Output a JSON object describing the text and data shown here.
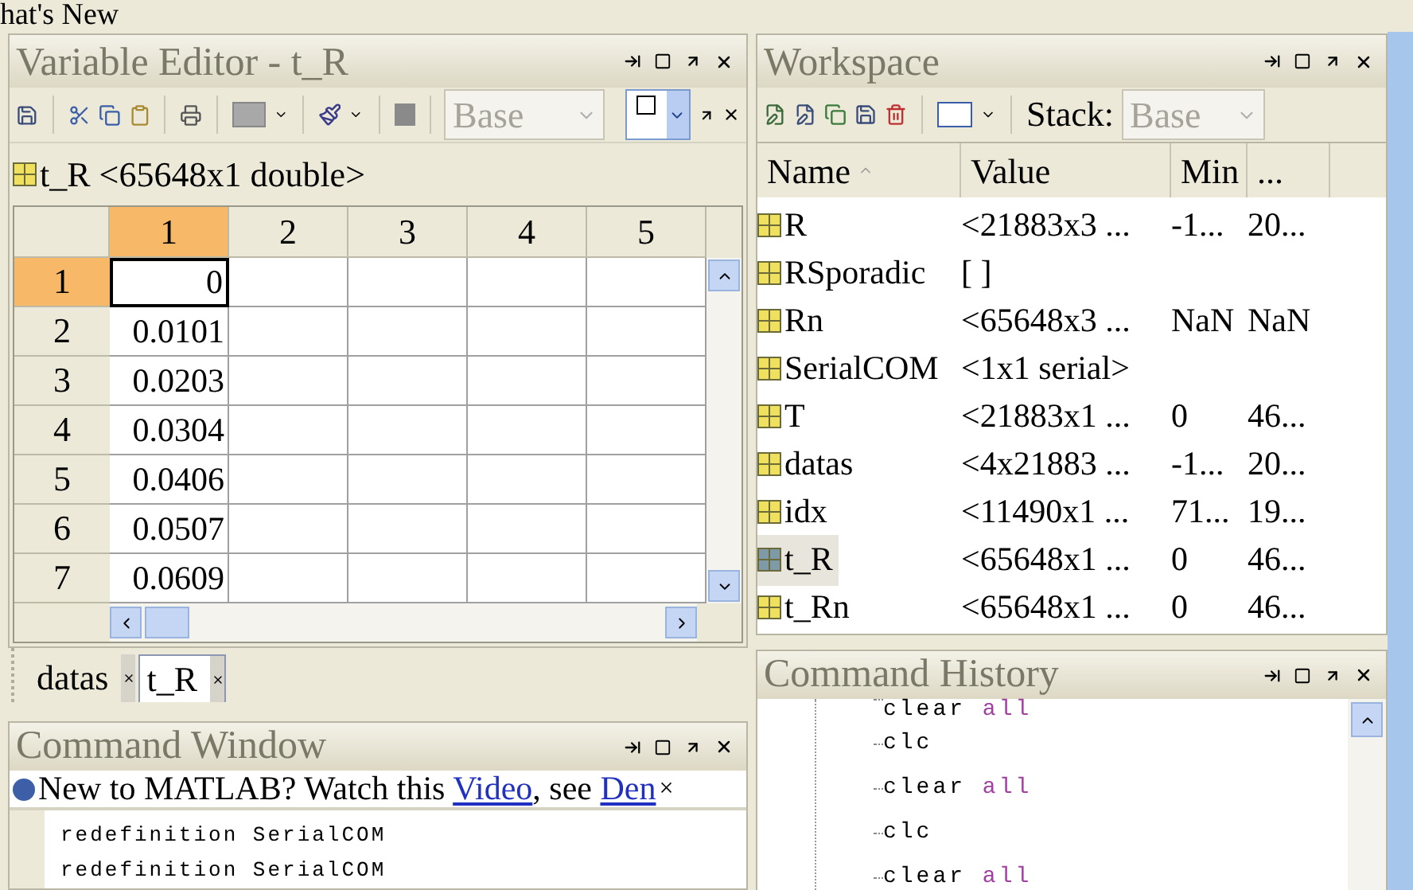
{
  "top_strip": {
    "text": "hat's New"
  },
  "variable_editor": {
    "title": "Variable Editor - t_R",
    "toolbar": {
      "base_dropdown": {
        "value": "Base",
        "disabled": true
      }
    },
    "variable_label": "t_R <65648x1 double>",
    "grid": {
      "columns": [
        {
          "label": "1",
          "selected": true
        },
        {
          "label": "2",
          "selected": false
        },
        {
          "label": "3",
          "selected": false
        },
        {
          "label": "4",
          "selected": false
        },
        {
          "label": "5",
          "selected": false
        }
      ],
      "rows": [
        {
          "label": "1",
          "selected": true,
          "value": "0"
        },
        {
          "label": "2",
          "selected": false,
          "value": "0.0101"
        },
        {
          "label": "3",
          "selected": false,
          "value": "0.0203"
        },
        {
          "label": "4",
          "selected": false,
          "value": "0.0304"
        },
        {
          "label": "5",
          "selected": false,
          "value": "0.0406"
        },
        {
          "label": "6",
          "selected": false,
          "value": "0.0507"
        },
        {
          "label": "7",
          "selected": false,
          "value": "0.0609"
        }
      ]
    },
    "tabs": [
      {
        "label": "datas",
        "selected": false
      },
      {
        "label": "t_R",
        "selected": true
      }
    ]
  },
  "command_window": {
    "title": "Command Window",
    "banner": [
      {
        "kind": "text",
        "text": "New to MATLAB? Watch this "
      },
      {
        "kind": "link",
        "text": "Video"
      },
      {
        "kind": "text",
        "text": ", see "
      },
      {
        "kind": "link",
        "text": "Den"
      }
    ],
    "banner_close": "×",
    "lines": [
      "redefinition SerialCOM",
      "redefinition SerialCOM"
    ]
  },
  "workspace": {
    "title": "Workspace",
    "toolbar": {
      "stack_label": "Stack:",
      "stack_dropdown": {
        "value": "Base",
        "disabled": true
      }
    },
    "columns": [
      "Name",
      "Value",
      "Min",
      "..."
    ],
    "rows": [
      {
        "name": "R",
        "value": "<21883x3 ...",
        "min": "-1...",
        "max": "20...",
        "selected": false
      },
      {
        "name": "RSporadic",
        "value": "[ ]",
        "min": "",
        "max": "",
        "selected": false
      },
      {
        "name": "Rn",
        "value": "<65648x3 ...",
        "min": "NaN",
        "max": "NaN",
        "selected": false
      },
      {
        "name": "SerialCOM",
        "value": "<1x1 serial>",
        "min": "",
        "max": "",
        "selected": false
      },
      {
        "name": "T",
        "value": "<21883x1 ...",
        "min": "0",
        "max": "46...",
        "selected": false
      },
      {
        "name": "datas",
        "value": "<4x21883 ...",
        "min": "-1...",
        "max": "20...",
        "selected": false
      },
      {
        "name": "idx",
        "value": "<11490x1 ...",
        "min": "71...",
        "max": "19...",
        "selected": false
      },
      {
        "name": "t_R",
        "value": "<65648x1 ...",
        "min": "0",
        "max": "46...",
        "selected": true
      },
      {
        "name": "t_Rn",
        "value": "<65648x1 ...",
        "min": "0",
        "max": "46...",
        "selected": false
      }
    ]
  },
  "command_history": {
    "title": "Command History",
    "items": [
      {
        "command": "clear",
        "argument": "all"
      },
      {
        "command": "clc"
      },
      {
        "command": "clear",
        "argument": "all"
      },
      {
        "command": "clc"
      },
      {
        "command": "clear",
        "argument": "all"
      }
    ]
  }
}
